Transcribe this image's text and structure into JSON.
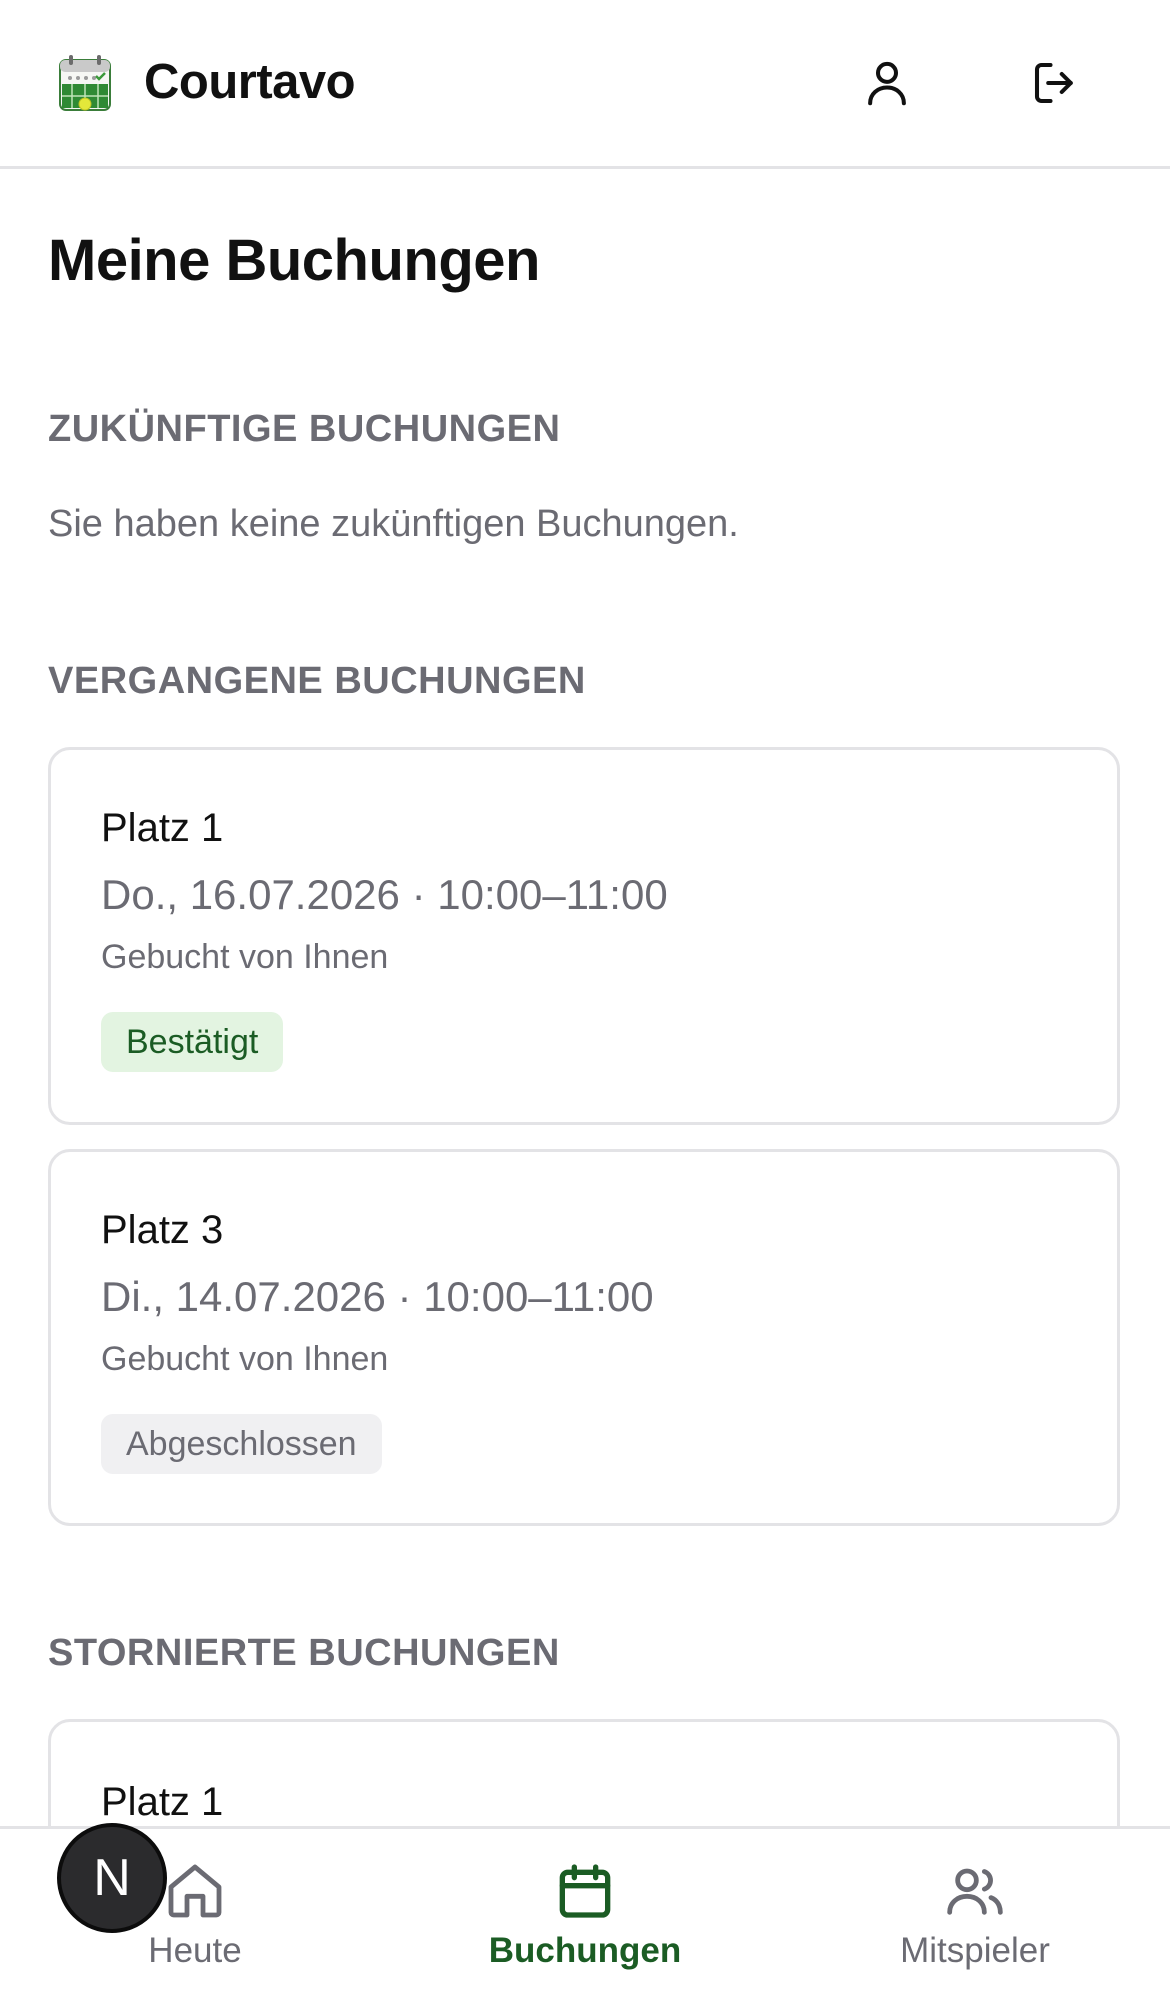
{
  "header": {
    "app_name": "Courtavo",
    "logo_icon": "calendar-court-logo",
    "profile_icon": "user-icon",
    "logout_icon": "logout-icon"
  },
  "page": {
    "title": "Meine Buchungen"
  },
  "sections": {
    "upcoming": {
      "title": "ZUKÜNFTIGE BUCHUNGEN",
      "empty_text": "Sie haben keine zukünftigen Buchungen."
    },
    "past": {
      "title": "VERGANGENE BUCHUNGEN",
      "bookings": [
        {
          "court": "Platz 1",
          "when": "Do., 16.07.2026 · 10:00–11:00",
          "booked_by": "Gebucht von Ihnen",
          "status": "Bestätigt"
        },
        {
          "court": "Platz 3",
          "when": "Di., 14.07.2026 · 10:00–11:00",
          "booked_by": "Gebucht von Ihnen",
          "status": "Abgeschlossen"
        }
      ]
    },
    "cancelled": {
      "title": "STORNIERTE BUCHUNGEN",
      "bookings": [
        {
          "court": "Platz 1"
        }
      ]
    }
  },
  "bottom_nav": {
    "items": [
      {
        "label": "Heute",
        "icon": "home-icon",
        "active": false
      },
      {
        "label": "Buchungen",
        "icon": "calendar-icon",
        "active": true
      },
      {
        "label": "Mitspieler",
        "icon": "users-icon",
        "active": false
      }
    ]
  },
  "dev_badge": {
    "letter": "N"
  },
  "colors": {
    "accent": "#1b5c24",
    "muted_text": "#6b6b73",
    "border": "#e3e3e6",
    "confirmed_bg": "#e3f4e1",
    "completed_bg": "#f0f0f2"
  }
}
